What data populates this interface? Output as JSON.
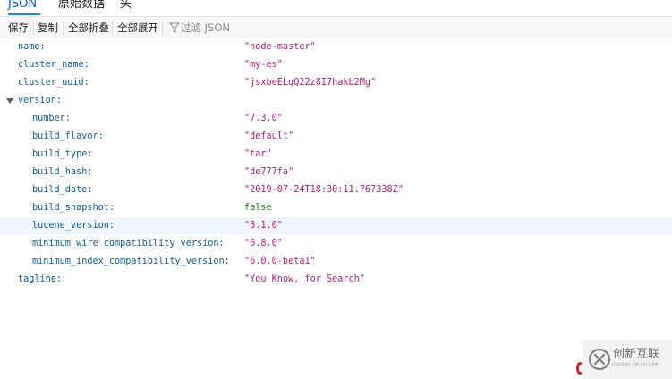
{
  "tabs": [
    {
      "label": "JSON",
      "active": true
    },
    {
      "label": "原始数据",
      "active": false
    },
    {
      "label": "头",
      "active": false
    }
  ],
  "toolbar": {
    "save_label": "保存",
    "copy_label": "复制",
    "collapse_all_label": "全部折叠",
    "expand_all_label": "全部展开",
    "filter_placeholder": "过滤 JSON"
  },
  "rows": [
    {
      "key": "name:",
      "value": "\"node-master\"",
      "type": "string",
      "depth": 0
    },
    {
      "key": "cluster_name:",
      "value": "\"my-es\"",
      "type": "string",
      "depth": 0
    },
    {
      "key": "cluster_uuid:",
      "value": "\"jsxbeELqQ22z8I7hakb2Mg\"",
      "type": "string",
      "depth": 0
    },
    {
      "key": "version:",
      "value": "",
      "type": "object",
      "depth": 0,
      "expanded": true
    },
    {
      "key": "number:",
      "value": "\"7.3.0\"",
      "type": "string",
      "depth": 1
    },
    {
      "key": "build_flavor:",
      "value": "\"default\"",
      "type": "string",
      "depth": 1
    },
    {
      "key": "build_type:",
      "value": "\"tar\"",
      "type": "string",
      "depth": 1
    },
    {
      "key": "build_hash:",
      "value": "\"de777fa\"",
      "type": "string",
      "depth": 1
    },
    {
      "key": "build_date:",
      "value": "\"2019-07-24T18:30:11.767338Z\"",
      "type": "string",
      "depth": 1
    },
    {
      "key": "build_snapshot:",
      "value": "false",
      "type": "bool",
      "depth": 1
    },
    {
      "key": "lucene_version:",
      "value": "\"8.1.0\"",
      "type": "string",
      "depth": 1,
      "highlight": true
    },
    {
      "key": "minimum_wire_compatibility_version:",
      "value": "\"6.8.0\"",
      "type": "string",
      "depth": 1
    },
    {
      "key": "minimum_index_compatibility_version:",
      "value": "\"6.0.0-beta1\"",
      "type": "string",
      "depth": 1
    },
    {
      "key": "tagline:",
      "value": "\"You Know, for Search\"",
      "type": "string",
      "depth": 0
    }
  ],
  "watermark": {
    "text": "创新互联",
    "subtext": "CHUANG XIN HU LIAN"
  },
  "colors": {
    "key": "#0b5cab",
    "string": "#c51673",
    "bool": "#14800e",
    "active_tab": "#0a84ff"
  }
}
